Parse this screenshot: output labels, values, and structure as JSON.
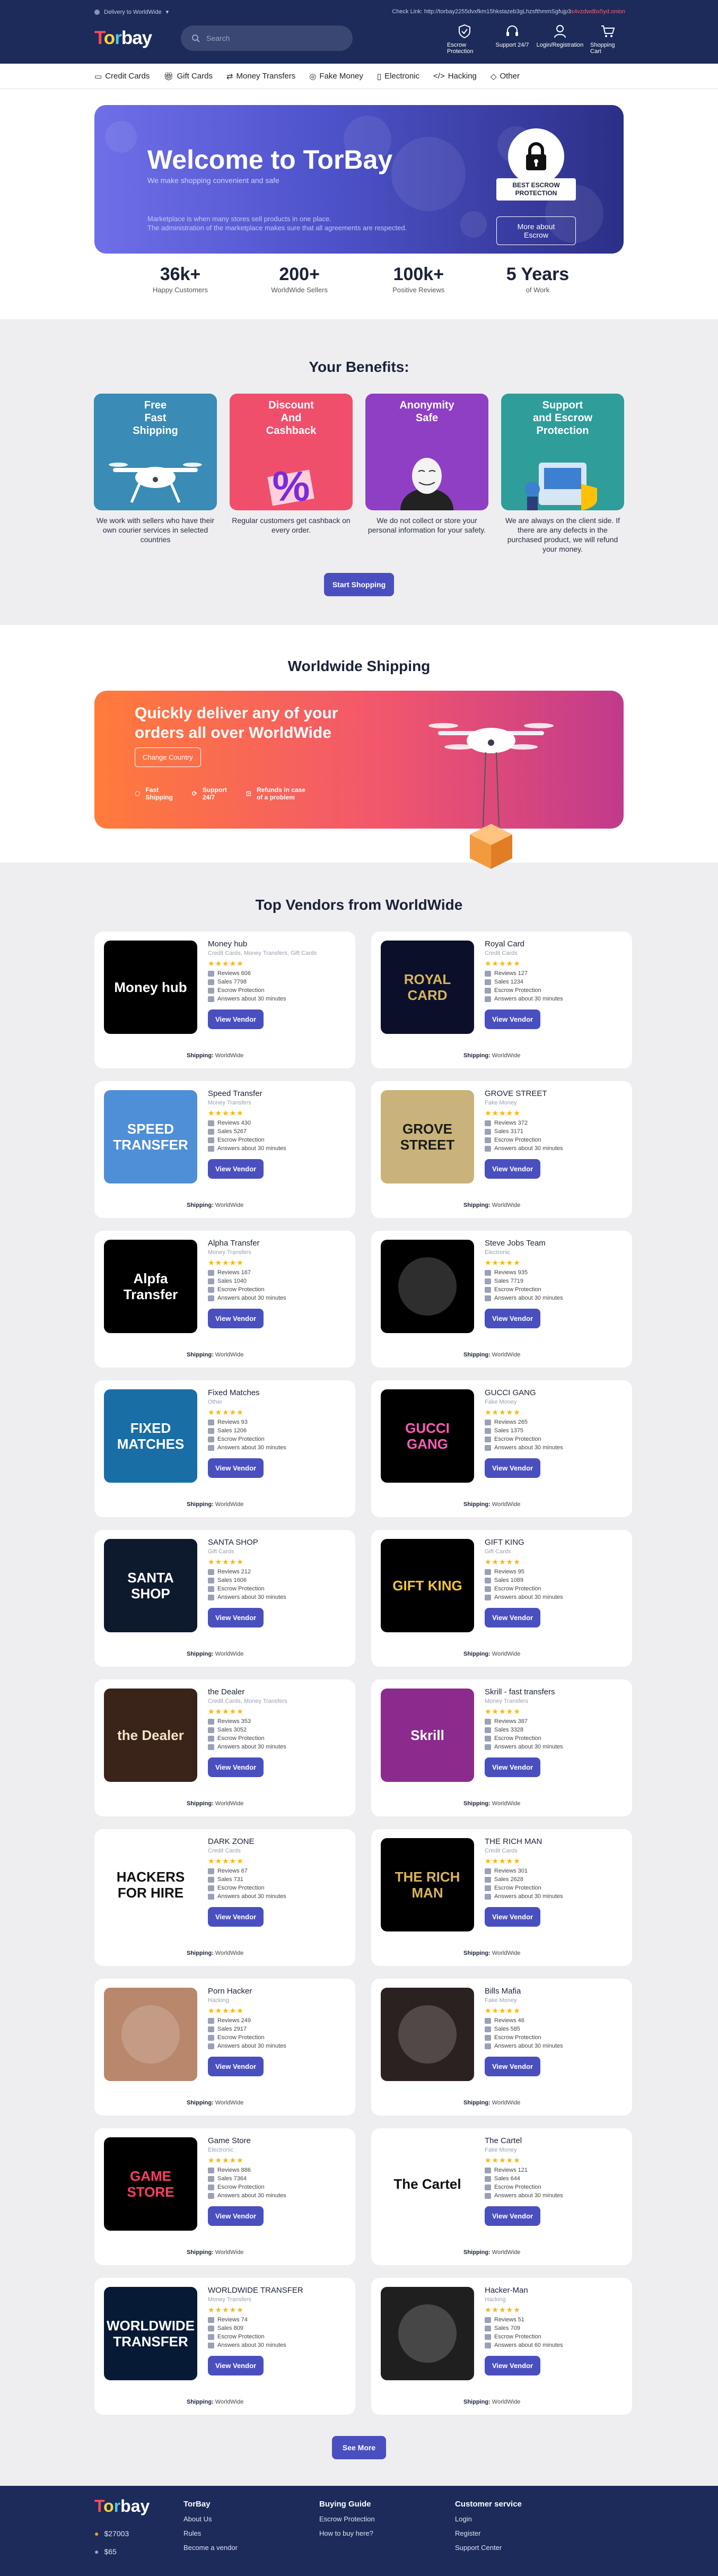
{
  "header": {
    "deliver": "Delivery to WorldWide",
    "onion_label": "Check Link:",
    "onion_url": "http://torbay2255dvxfkm15hkstazeb3gLhzsfthmmSgfujp3",
    "onion_tail": "s4vzdwdbx5yd.onion",
    "logo_parts": [
      "T",
      "o",
      "r",
      "bay"
    ],
    "search_placeholder": "Search",
    "icons": [
      {
        "label": "Escrow Protection",
        "icon": "shield-icon"
      },
      {
        "label": "Support 24/7",
        "icon": "headset-icon"
      },
      {
        "label": "Login/Registration",
        "icon": "user-icon"
      },
      {
        "label": "Shopping Cart",
        "icon": "cart-icon"
      }
    ]
  },
  "categories": [
    "Credit Cards",
    "Gift Cards",
    "Money Transfers",
    "Fake Money",
    "Electronic",
    "Hacking",
    "Other"
  ],
  "hero": {
    "title": "Welcome to TorBay",
    "subtitle": "We make shopping convenient and safe",
    "desc1": "Marketplace is when many stores sell products in one place.",
    "desc2": "The administration of the marketplace makes sure that all agreements are respected.",
    "badge_line1": "BEST ESCROW",
    "badge_line2": "PROTECTION",
    "button": "More about Escrow"
  },
  "stats": [
    {
      "value": "36k+",
      "label": "Happy Customers"
    },
    {
      "value": "200+",
      "label": "WorldWide Sellers"
    },
    {
      "value": "100k+",
      "label": "Positive Reviews"
    },
    {
      "value": "5 Years",
      "label": "of Work"
    }
  ],
  "benefits": {
    "title": "Your Benefits:",
    "items": [
      {
        "title": "Free\nFast\nShipping",
        "text": "We work with sellers who have their own courier services in selected countries",
        "color": "#3a8bb5"
      },
      {
        "title": "Discount\nAnd\nCashback",
        "text": "Regular customers get cashback on every order.",
        "color": "#f04f6c"
      },
      {
        "title": "Anonymity\nSafe",
        "text": "We do not collect or store your personal information for your safety.",
        "color": "#8f3fc4"
      },
      {
        "title": "Support\nand Escrow\nProtection",
        "text": "We are always on the client side. If there are any defects in the purchased product, we will refund your money.",
        "color": "#2f9d9a"
      }
    ],
    "button": "Start Shopping"
  },
  "shipping": {
    "title": "Worldwide Shipping",
    "headline": "Quickly deliver any of your orders all over WorldWide",
    "button": "Change Country",
    "features": [
      "Fast\nShipping",
      "Support\n24/7",
      "Refunds in case\nof a problem"
    ]
  },
  "vendors": {
    "title": "Top Vendors from WorldWide",
    "reviews_label": "Reviews",
    "sales_label": "Sales",
    "escrow_label": "Escrow Protection",
    "answer_prefix": "Answers about",
    "button": "View Vendor",
    "shipping_label": "Shipping:",
    "shipping_value": "WorldWide",
    "items": [
      {
        "name": "Money hub",
        "cat": "Credit Cards, Money Transfers, Gift Cards",
        "reviews": "606",
        "sales": "7798",
        "answer": "30 minutes",
        "img": "Money hub",
        "bg": "#000000",
        "fg": "#ffffff"
      },
      {
        "name": "Royal Card",
        "cat": "Credit Cards",
        "reviews": "127",
        "sales": "1234",
        "answer": "30 minutes",
        "img": "ROYAL CARD",
        "bg": "#0b0f2a",
        "fg": "#d8b45a"
      },
      {
        "name": "Speed Transfer",
        "cat": "Money Transfers",
        "reviews": "430",
        "sales": "5267",
        "answer": "30 minutes",
        "img": "SPEED TRANSFER",
        "bg": "#4f8fd8",
        "fg": "#ffffff"
      },
      {
        "name": "GROVE STREET",
        "cat": "Fake Money",
        "reviews": "372",
        "sales": "3171",
        "answer": "30 minutes",
        "img": "GROVE STREET",
        "bg": "#c9b37a",
        "fg": "#1a1a1a"
      },
      {
        "name": "Alpha Transfer",
        "cat": "Money Transfers",
        "reviews": "167",
        "sales": "1040",
        "answer": "30 minutes",
        "img": "Alpfa Transfer",
        "bg": "#000000",
        "fg": "#ffffff"
      },
      {
        "name": "Steve Jobs Team",
        "cat": "Electronic",
        "reviews": "935",
        "sales": "7719",
        "answer": "30 minutes",
        "img": "",
        "bg": "#000000",
        "fg": "#ffffff"
      },
      {
        "name": "Fixed Matches",
        "cat": "Other",
        "reviews": "93",
        "sales": "1206",
        "answer": "30 minutes",
        "img": "FIXED MATCHES",
        "bg": "#1a6ea6",
        "fg": "#ffffff"
      },
      {
        "name": "GUCCI GANG",
        "cat": "Fake Money",
        "reviews": "265",
        "sales": "1375",
        "answer": "30 minutes",
        "img": "GUCCI GANG",
        "bg": "#000000",
        "fg": "#ff5bb8"
      },
      {
        "name": "SANTA SHOP",
        "cat": "Gift Cards",
        "reviews": "212",
        "sales": "1606",
        "answer": "30 minutes",
        "img": "SANTA SHOP",
        "bg": "#0d1a2e",
        "fg": "#ffffff"
      },
      {
        "name": "GIFT KING",
        "cat": "Gift Cards",
        "reviews": "95",
        "sales": "1089",
        "answer": "30 minutes",
        "img": "GIFT KING",
        "bg": "#000000",
        "fg": "#f5c43a"
      },
      {
        "name": "the Dealer",
        "cat": "Credit Cards, Money Transfers",
        "reviews": "353",
        "sales": "3052",
        "answer": "30 minutes",
        "img": "the Dealer",
        "bg": "#3a2318",
        "fg": "#f3e3c8"
      },
      {
        "name": "Skrill - fast transfers",
        "cat": "Money Transfers",
        "reviews": "387",
        "sales": "3328",
        "answer": "30 minutes",
        "img": "Skrill",
        "bg": "#8b2b8e",
        "fg": "#ffffff"
      },
      {
        "name": "DARK ZONE",
        "cat": "Credit Cards",
        "reviews": "67",
        "sales": "731",
        "answer": "30 minutes",
        "img": "HACKERS FOR HIRE",
        "bg": "#ffffff",
        "fg": "#111111"
      },
      {
        "name": "THE RICH MAN",
        "cat": "Credit Cards",
        "reviews": "301",
        "sales": "2628",
        "answer": "30 minutes",
        "img": "THE RICH MAN",
        "bg": "#000000",
        "fg": "#d8b45a"
      },
      {
        "name": "Porn Hacker",
        "cat": "Hacking",
        "reviews": "249",
        "sales": "2917",
        "answer": "30 minutes",
        "img": "",
        "bg": "#b8876c",
        "fg": "#ffffff"
      },
      {
        "name": "Bills Mafia",
        "cat": "Fake Money",
        "reviews": "46",
        "sales": "585",
        "answer": "30 minutes",
        "img": "",
        "bg": "#2a2220",
        "fg": "#ffffff"
      },
      {
        "name": "Game Store",
        "cat": "Electronic",
        "reviews": "886",
        "sales": "7364",
        "answer": "30 minutes",
        "img": "GAME STORE",
        "bg": "#000000",
        "fg": "#ff3c6a"
      },
      {
        "name": "The Cartel",
        "cat": "Fake Money",
        "reviews": "121",
        "sales": "644",
        "answer": "30 minutes",
        "img": "The Cartel",
        "bg": "#ffffff",
        "fg": "#111111"
      },
      {
        "name": "WORLDWIDE TRANSFER",
        "cat": "Money Transfers",
        "reviews": "74",
        "sales": "809",
        "answer": "30 minutes",
        "img": "WORLDWIDE TRANSFER",
        "bg": "#061a36",
        "fg": "#ffffff"
      },
      {
        "name": "Hacker-Man",
        "cat": "Hacking",
        "reviews": "51",
        "sales": "709",
        "answer": "60 minutes",
        "img": "",
        "bg": "#1f1f1f",
        "fg": "#f5c43a"
      }
    ]
  },
  "see_more": "See More",
  "footer": {
    "balance_btc": "$27003",
    "balance_other": "$65",
    "cols": [
      {
        "title": "TorBay",
        "items": [
          "About Us",
          "Rules",
          "Become a vendor"
        ]
      },
      {
        "title": "Buying Guide",
        "items": [
          "Escrow Protection",
          "How to buy here?"
        ]
      },
      {
        "title": "Customer service",
        "items": [
          "Login",
          "Register",
          "Support Center"
        ]
      }
    ]
  },
  "colors": {
    "navy": "#1c2b5a",
    "accent": "#4a4fbf",
    "star": "#ffb400"
  }
}
